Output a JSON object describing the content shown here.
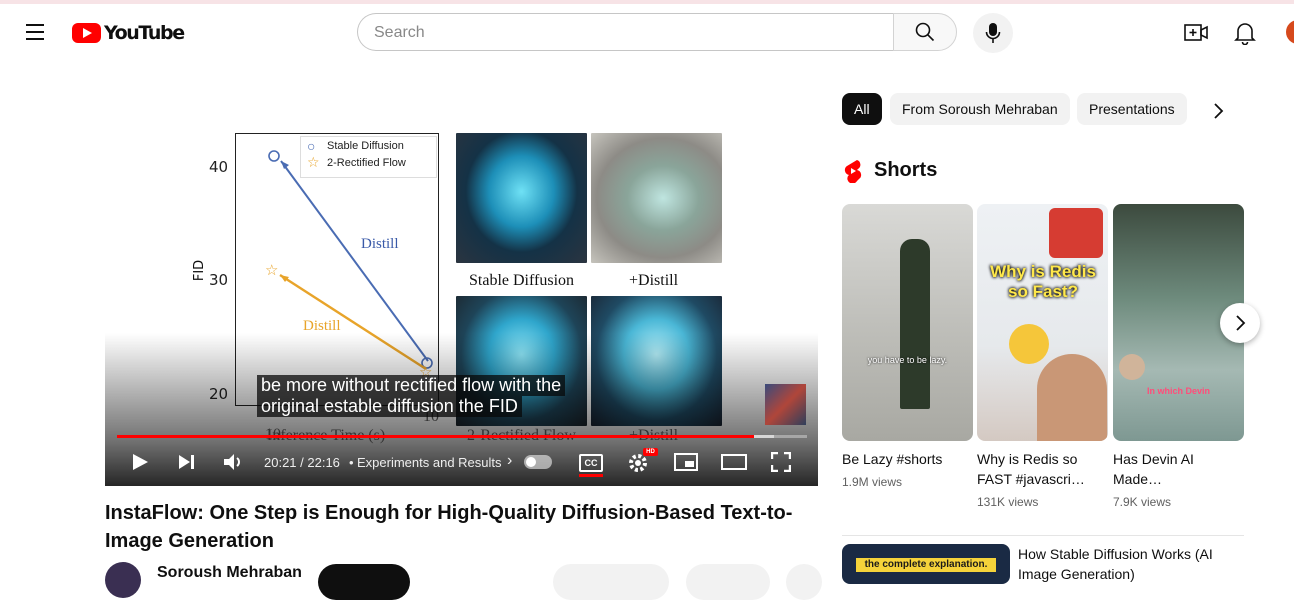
{
  "header": {
    "logo_text": "YouTube",
    "search_placeholder": "Search"
  },
  "video": {
    "chart": {
      "y_ticks": [
        "40",
        "30",
        "20"
      ],
      "y_label": "FID",
      "legend": [
        "Stable Diffusion",
        "2-Rectified Flow"
      ],
      "annot_blue": "Distill",
      "annot_orange": "Distill",
      "x_ticks": [
        "10",
        "10"
      ],
      "x_label": "Inference Time (s)"
    },
    "image_captions": [
      "Stable Diffusion",
      "+Distill",
      "2-Rectified Flow",
      "+Distill"
    ],
    "subtitle_line1": "be more without rectified flow with the",
    "subtitle_line2": "original estable diffusion the FID",
    "progress_fraction": 0.923,
    "time_display": "20:21 / 22:16",
    "chapter": "Experiments and Results",
    "chapter_arrow": "›"
  },
  "title": "InstaFlow: One Step is Enough for High-Quality Diffusion-Based Text-to-Image Generation",
  "channel_name": "Soroush Mehraban",
  "chips": [
    "All",
    "From Soroush Mehraban",
    "Presentations"
  ],
  "shorts": {
    "heading": "Shorts",
    "items": [
      {
        "title": "Be Lazy #shorts",
        "views": "1.9M views",
        "overlay": "you have to be lazy."
      },
      {
        "title": "Why is Redis so FAST #javascri…",
        "views": "131K views",
        "overlay": "Why is Redis so Fast?"
      },
      {
        "title": "Has Devin AI Made…",
        "views": "7.9K views",
        "overlay": "In which Devin"
      }
    ]
  },
  "recommended": {
    "title": "How Stable Diffusion Works (AI Image Generation)",
    "thumb_text": "the complete explanation."
  },
  "colors": {
    "brand_red": "#ff0000",
    "stable_diffusion_blue": "#4a6cb3",
    "rectified_flow_orange": "#e8a42a"
  }
}
